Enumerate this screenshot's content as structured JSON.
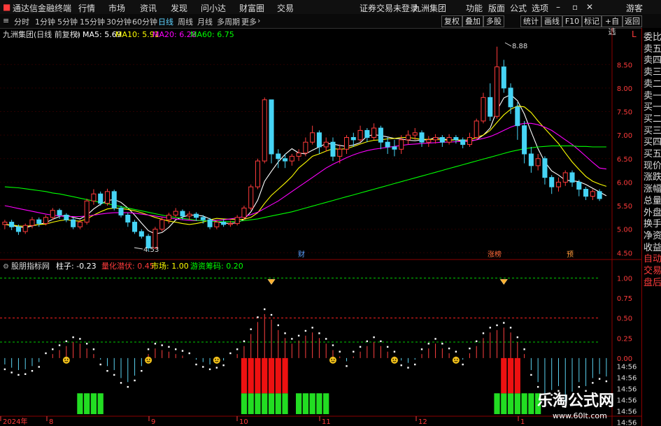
{
  "app": {
    "title": "通达信金融终端",
    "menu": [
      "行情",
      "市场",
      "资讯",
      "发现",
      "问小达",
      "财富圈",
      "交易"
    ],
    "notice": "证券交易未登录",
    "stock_name": "九洲集团",
    "right_menu": [
      "功能",
      "版面",
      "公式",
      "选项"
    ],
    "user": "游客"
  },
  "toolbar": {
    "periods": [
      "分时",
      "1分钟",
      "5分钟",
      "15分钟",
      "30分钟",
      "60分钟",
      "日线",
      "周线",
      "月线",
      "多周期",
      "更多"
    ],
    "active_period": "日线",
    "buttons": [
      "复权",
      "叠加",
      "多股",
      "统计",
      "画线",
      "F10",
      "标记",
      "+自选",
      "返回"
    ]
  },
  "main_chart": {
    "title": "九洲集团(日线 前复权)",
    "ma_labels": [
      "MA5: 5.69",
      "MA10: 5.91",
      "MA20: 6.28",
      "MA60: 6.75"
    ],
    "ma_colors": [
      "#ffffff",
      "#ffff00",
      "#ff00ff",
      "#00ff00"
    ],
    "yticks": [
      "8.50",
      "8.00",
      "7.50",
      "7.00",
      "6.50",
      "6.00",
      "5.50",
      "5.00",
      "4.50"
    ],
    "high_label": "8.88",
    "low_label": "4.53",
    "markers": [
      "财",
      "涨榜",
      "预"
    ],
    "right_marker": "L"
  },
  "chart_data": {
    "type": "candlestick",
    "title": "九洲集团(日线 前复权)",
    "ylim": [
      4.4,
      8.95
    ],
    "high": 8.88,
    "low": 4.53,
    "ma": {
      "MA5": 5.69,
      "MA10": 5.91,
      "MA20": 6.28,
      "MA60": 6.75
    },
    "candles": [
      [
        5.1,
        5.15,
        5.0,
        5.2
      ],
      [
        5.15,
        5.05,
        4.98,
        5.2
      ],
      [
        5.05,
        4.95,
        4.88,
        5.1
      ],
      [
        4.95,
        5.08,
        4.9,
        5.12
      ],
      [
        5.08,
        5.2,
        5.02,
        5.26
      ],
      [
        5.2,
        5.12,
        5.05,
        5.25
      ],
      [
        5.12,
        5.25,
        5.08,
        5.3
      ],
      [
        5.25,
        5.4,
        5.2,
        5.45
      ],
      [
        5.4,
        5.3,
        5.22,
        5.44
      ],
      [
        5.3,
        5.2,
        5.15,
        5.34
      ],
      [
        5.2,
        5.05,
        5.0,
        5.24
      ],
      [
        5.05,
        5.15,
        5.0,
        5.2
      ],
      [
        5.15,
        5.6,
        5.1,
        5.65
      ],
      [
        5.6,
        5.75,
        5.52,
        5.85
      ],
      [
        5.75,
        5.55,
        5.5,
        5.8
      ],
      [
        5.55,
        5.8,
        5.5,
        5.86
      ],
      [
        5.8,
        5.45,
        5.4,
        5.84
      ],
      [
        5.45,
        5.3,
        5.25,
        5.5
      ],
      [
        5.3,
        5.15,
        5.05,
        5.35
      ],
      [
        5.15,
        4.95,
        4.9,
        5.2
      ],
      [
        4.95,
        4.85,
        4.8,
        5.0
      ],
      [
        4.85,
        4.6,
        4.53,
        4.9
      ],
      [
        4.6,
        5.0,
        4.58,
        5.05
      ],
      [
        5.0,
        5.2,
        4.95,
        5.25
      ],
      [
        5.2,
        5.3,
        5.12,
        5.35
      ],
      [
        5.3,
        5.38,
        5.25,
        5.45
      ],
      [
        5.38,
        5.28,
        5.2,
        5.42
      ],
      [
        5.28,
        5.32,
        5.2,
        5.38
      ],
      [
        5.32,
        5.25,
        5.18,
        5.36
      ],
      [
        5.25,
        5.2,
        5.12,
        5.3
      ],
      [
        5.2,
        5.05,
        5.0,
        5.24
      ],
      [
        5.05,
        5.15,
        5.0,
        5.2
      ],
      [
        5.15,
        5.1,
        5.05,
        5.22
      ],
      [
        5.1,
        5.12,
        5.05,
        5.18
      ],
      [
        5.12,
        5.25,
        5.08,
        5.3
      ],
      [
        5.25,
        5.45,
        5.2,
        5.5
      ],
      [
        5.45,
        5.9,
        5.4,
        5.95
      ],
      [
        5.9,
        6.45,
        5.85,
        6.5
      ],
      [
        6.45,
        7.75,
        6.4,
        7.8
      ],
      [
        7.75,
        6.6,
        6.4,
        7.4
      ],
      [
        6.6,
        6.5,
        6.3,
        6.7
      ],
      [
        6.5,
        6.45,
        6.3,
        6.6
      ],
      [
        6.45,
        6.55,
        6.35,
        6.6
      ],
      [
        6.55,
        6.62,
        6.45,
        6.7
      ],
      [
        6.62,
        6.85,
        6.55,
        6.95
      ],
      [
        6.85,
        7.05,
        6.8,
        7.2
      ],
      [
        7.05,
        6.75,
        6.6,
        7.1
      ],
      [
        6.75,
        6.85,
        6.65,
        6.95
      ],
      [
        6.85,
        6.55,
        6.45,
        6.95
      ],
      [
        6.55,
        6.7,
        6.4,
        6.8
      ],
      [
        6.7,
        6.95,
        6.6,
        7.0
      ],
      [
        6.95,
        6.9,
        6.75,
        7.05
      ],
      [
        6.9,
        7.1,
        6.85,
        7.2
      ],
      [
        7.1,
        6.95,
        6.85,
        7.15
      ],
      [
        6.95,
        7.15,
        6.9,
        7.25
      ],
      [
        7.15,
        6.85,
        6.7,
        7.2
      ],
      [
        6.85,
        6.75,
        6.6,
        6.95
      ],
      [
        6.75,
        6.7,
        6.55,
        6.9
      ],
      [
        6.7,
        6.9,
        6.6,
        7.0
      ],
      [
        6.9,
        7.0,
        6.8,
        7.1
      ],
      [
        7.0,
        7.05,
        6.9,
        7.15
      ],
      [
        7.05,
        6.85,
        6.75,
        7.1
      ],
      [
        6.85,
        6.9,
        6.75,
        6.98
      ],
      [
        6.9,
        6.95,
        6.82,
        7.02
      ],
      [
        6.95,
        6.85,
        6.75,
        7.0
      ],
      [
        6.85,
        6.95,
        6.8,
        7.02
      ],
      [
        6.95,
        6.9,
        6.82,
        7.0
      ],
      [
        6.9,
        6.8,
        6.72,
        6.95
      ],
      [
        6.8,
        6.95,
        6.75,
        7.05
      ],
      [
        6.95,
        7.3,
        6.9,
        7.35
      ],
      [
        7.3,
        7.8,
        7.25,
        7.9
      ],
      [
        7.8,
        7.4,
        7.3,
        8.1
      ],
      [
        7.4,
        8.45,
        7.35,
        8.88
      ],
      [
        8.45,
        8.0,
        7.9,
        8.6
      ],
      [
        8.0,
        7.6,
        7.45,
        8.1
      ],
      [
        7.6,
        7.2,
        6.9,
        7.7
      ],
      [
        7.2,
        6.6,
        6.4,
        7.3
      ],
      [
        6.6,
        6.35,
        6.2,
        6.75
      ],
      [
        6.35,
        6.5,
        6.25,
        6.6
      ],
      [
        6.5,
        6.1,
        5.95,
        6.55
      ],
      [
        6.1,
        5.9,
        5.75,
        6.15
      ],
      [
        5.9,
        6.0,
        5.8,
        6.1
      ],
      [
        6.0,
        6.2,
        5.92,
        6.25
      ],
      [
        6.2,
        6.0,
        5.9,
        6.25
      ],
      [
        6.0,
        5.85,
        5.7,
        6.05
      ],
      [
        5.85,
        5.7,
        5.62,
        5.9
      ],
      [
        5.7,
        5.8,
        5.62,
        5.85
      ],
      [
        5.8,
        5.65,
        5.6,
        5.85
      ]
    ],
    "ma5": [
      5.1,
      5.08,
      5.05,
      5.03,
      5.07,
      5.1,
      5.14,
      5.21,
      5.27,
      5.3,
      5.25,
      5.22,
      5.3,
      5.43,
      5.53,
      5.61,
      5.63,
      5.57,
      5.45,
      5.3,
      5.13,
      4.97,
      4.9,
      4.93,
      5.04,
      5.2,
      5.26,
      5.3,
      5.3,
      5.28,
      5.22,
      5.16,
      5.13,
      5.12,
      5.14,
      5.21,
      5.37,
      5.62,
      6.02,
      6.23,
      6.43,
      6.59,
      6.71,
      6.62,
      6.6,
      6.68,
      6.75,
      6.82,
      6.81,
      6.78,
      6.76,
      6.79,
      6.84,
      6.98,
      7.01,
      6.99,
      6.96,
      6.93,
      6.92,
      6.89,
      6.88,
      6.9,
      6.9,
      6.95,
      6.92,
      6.9,
      6.9,
      6.87,
      6.87,
      6.9,
      7.0,
      7.15,
      7.53,
      7.79,
      7.86,
      7.73,
      7.45,
      7.07,
      6.71,
      6.43,
      6.24,
      6.15,
      6.04,
      6.03,
      6.01,
      5.95,
      5.87,
      5.79,
      5.71
    ],
    "ma10": [
      5.1,
      5.09,
      5.07,
      5.06,
      5.08,
      5.1,
      5.11,
      5.15,
      5.18,
      5.2,
      5.18,
      5.17,
      5.22,
      5.3,
      5.37,
      5.43,
      5.45,
      5.44,
      5.42,
      5.39,
      5.35,
      5.3,
      5.25,
      5.21,
      5.17,
      5.15,
      5.12,
      5.1,
      5.12,
      5.15,
      5.2,
      5.23,
      5.22,
      5.21,
      5.21,
      5.21,
      5.25,
      5.35,
      5.55,
      5.72,
      5.85,
      5.98,
      6.12,
      6.3,
      6.42,
      6.55,
      6.6,
      6.66,
      6.71,
      6.7,
      6.71,
      6.76,
      6.81,
      6.86,
      6.89,
      6.9,
      6.92,
      6.93,
      6.95,
      6.95,
      6.93,
      6.91,
      6.91,
      6.91,
      6.9,
      6.89,
      6.9,
      6.89,
      6.9,
      6.95,
      7.0,
      7.1,
      7.27,
      7.43,
      7.55,
      7.62,
      7.6,
      7.48,
      7.3,
      7.14,
      6.98,
      6.82,
      6.62,
      6.43,
      6.27,
      6.12,
      6.02,
      5.96,
      5.91
    ],
    "ma20": [
      5.5,
      5.47,
      5.44,
      5.41,
      5.38,
      5.35,
      5.32,
      5.3,
      5.28,
      5.27,
      5.27,
      5.27,
      5.28,
      5.3,
      5.32,
      5.34,
      5.35,
      5.35,
      5.35,
      5.34,
      5.32,
      5.3,
      5.28,
      5.26,
      5.24,
      5.22,
      5.2,
      5.19,
      5.18,
      5.18,
      5.18,
      5.19,
      5.2,
      5.22,
      5.24,
      5.27,
      5.31,
      5.36,
      5.44,
      5.52,
      5.6,
      5.7,
      5.8,
      5.9,
      6.0,
      6.1,
      6.2,
      6.3,
      6.38,
      6.45,
      6.52,
      6.58,
      6.63,
      6.67,
      6.7,
      6.72,
      6.74,
      6.76,
      6.78,
      6.8,
      6.81,
      6.82,
      6.83,
      6.84,
      6.85,
      6.85,
      6.86,
      6.87,
      6.88,
      6.9,
      6.93,
      6.97,
      7.03,
      7.1,
      7.17,
      7.22,
      7.25,
      7.25,
      7.22,
      7.17,
      7.1,
      7.0,
      6.9,
      6.8,
      6.68,
      6.55,
      6.42,
      6.3,
      6.28
    ],
    "ma60": [
      5.9,
      5.89,
      5.88,
      5.86,
      5.84,
      5.82,
      5.8,
      5.77,
      5.75,
      5.72,
      5.69,
      5.66,
      5.63,
      5.6,
      5.57,
      5.54,
      5.51,
      5.48,
      5.45,
      5.42,
      5.39,
      5.36,
      5.33,
      5.3,
      5.27,
      5.25,
      5.23,
      5.21,
      5.19,
      5.18,
      5.17,
      5.16,
      5.16,
      5.16,
      5.17,
      5.18,
      5.2,
      5.22,
      5.25,
      5.28,
      5.31,
      5.34,
      5.37,
      5.41,
      5.45,
      5.49,
      5.53,
      5.57,
      5.61,
      5.65,
      5.69,
      5.73,
      5.77,
      5.81,
      5.85,
      5.89,
      5.93,
      5.97,
      6.01,
      6.05,
      6.09,
      6.13,
      6.17,
      6.21,
      6.25,
      6.29,
      6.33,
      6.37,
      6.41,
      6.45,
      6.49,
      6.53,
      6.57,
      6.61,
      6.65,
      6.68,
      6.71,
      6.73,
      6.75,
      6.76,
      6.77,
      6.77,
      6.77,
      6.77,
      6.76,
      6.76,
      6.75,
      6.75,
      6.75
    ],
    "indicator": {
      "name": "股朋指标网",
      "labels": [
        "柱子: -0.23",
        "量化潜伏: 0.45",
        "市场: 1.00",
        "游资筹码: 0.20"
      ],
      "label_colors": [
        "#ffffff",
        "#ff3b3b",
        "#ffff00",
        "#00ff00"
      ],
      "ylim": [
        -0.7,
        1.1
      ],
      "yticks": [
        "1.00",
        "0.75",
        "0.50",
        "0.25",
        "0.00"
      ],
      "side_values": [
        "14:56",
        "14:56",
        "14:56",
        "14:56",
        "14:56",
        "14:56"
      ],
      "bars": [
        -0.08,
        -0.12,
        -0.15,
        -0.14,
        -0.1,
        -0.05,
        0.0,
        0.05,
        0.1,
        0.15,
        0.2,
        0.18,
        0.12,
        0.05,
        -0.02,
        -0.1,
        -0.15,
        -0.25,
        -0.3,
        -0.22,
        -0.1,
        0.05,
        0.12,
        0.1,
        0.08,
        0.05,
        0.03,
        0.0,
        -0.02,
        -0.05,
        -0.08,
        -0.06,
        -0.03,
        0.0,
        0.05,
        0.15,
        0.3,
        0.45,
        0.55,
        0.48,
        0.35,
        0.25,
        0.18,
        0.22,
        0.28,
        0.32,
        0.25,
        0.18,
        0.1,
        0.02,
        -0.04,
        0.02,
        0.08,
        0.15,
        0.2,
        0.15,
        0.08,
        0.02,
        -0.03,
        -0.06,
        -0.02,
        0.05,
        0.12,
        0.18,
        0.12,
        0.06,
        0.02,
        -0.02,
        0.06,
        0.15,
        0.25,
        0.32,
        0.35,
        0.38,
        0.32,
        0.2,
        0.05,
        -0.15,
        -0.3,
        -0.45,
        -0.4,
        -0.35,
        -0.55,
        -0.42,
        -0.3,
        -0.35,
        -0.25,
        -0.2,
        -0.23
      ],
      "red_blocks": [
        [
          35,
          41
        ],
        [
          73,
          75
        ]
      ],
      "green_blocks": [
        [
          11,
          14
        ],
        [
          35,
          41
        ],
        [
          43,
          47
        ],
        [
          72,
          74
        ],
        [
          75,
          78
        ]
      ]
    },
    "xticks": [
      "2024年",
      "8",
      "9",
      "10",
      "11",
      "12",
      "1"
    ]
  },
  "sidebar": [
    "委比",
    "卖五",
    "卖四",
    "卖三",
    "卖二",
    "卖一",
    "买一",
    "买二",
    "买三",
    "买四",
    "买五",
    "现价",
    "涨跌",
    "涨幅",
    "总量",
    "外盘",
    "换手",
    "净资",
    "收益",
    "自动",
    "交易",
    "盘后"
  ],
  "watermark": {
    "title": "乐淘公式网",
    "url": "www.60lt.com"
  }
}
